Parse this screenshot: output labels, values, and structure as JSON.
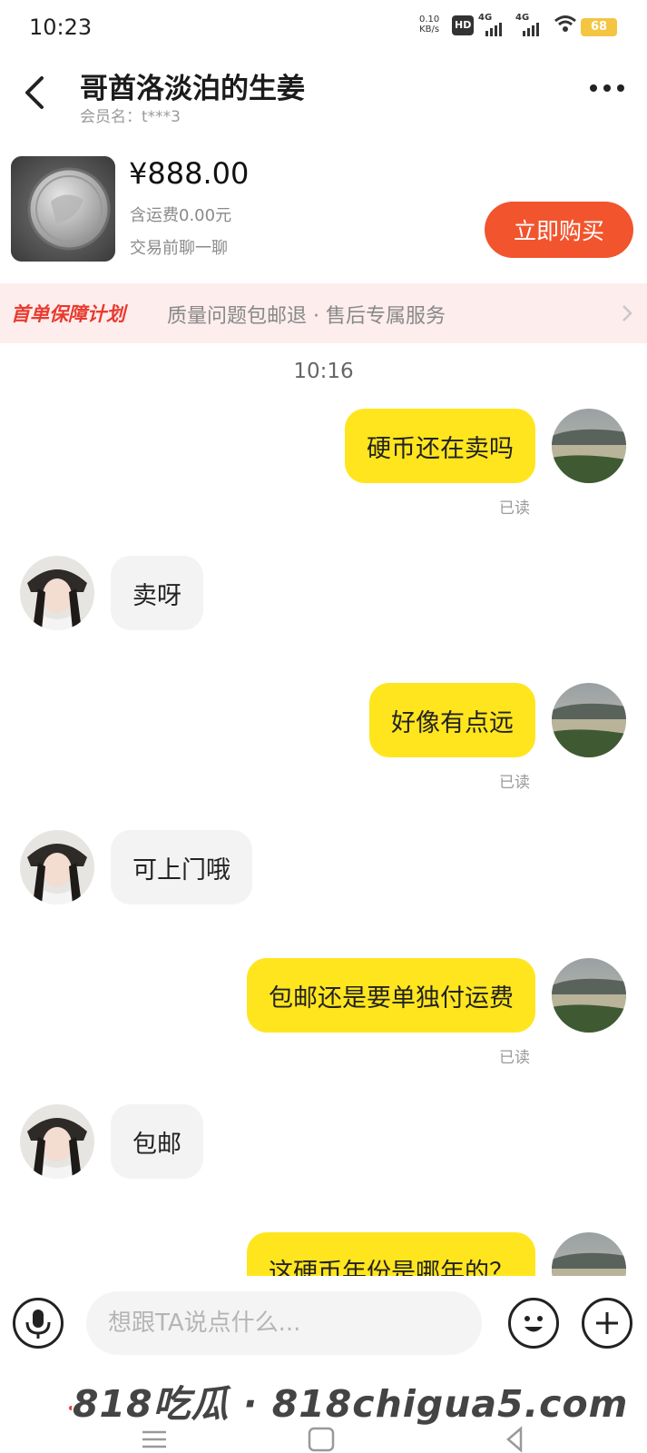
{
  "status_bar": {
    "time": "10:23",
    "net_speed_value": "0.10",
    "net_speed_unit": "KB/s",
    "hd_label": "HD",
    "signal_1_label": "4G",
    "signal_2_label": "4G",
    "battery": "68"
  },
  "header": {
    "title": "哥酋洛淡泊的生姜",
    "member_name": "会员名：t***3"
  },
  "product": {
    "price": "¥888.00",
    "shipping": "含运费0.00元",
    "chat_hint": "交易前聊一聊",
    "buy_label": "立即购买"
  },
  "protection": {
    "title": "首单保障计划",
    "text": "质量问题包邮退 · 售后专属服务"
  },
  "chat": {
    "time": "10:16",
    "messages": [
      {
        "text": "硬币还在卖吗",
        "status": "已读"
      },
      {
        "text": "卖呀"
      },
      {
        "text": "好像有点远",
        "status": "已读"
      },
      {
        "text": "可上门哦"
      },
      {
        "text": "包邮还是要单独付运费",
        "status": "已读"
      },
      {
        "text": "包邮"
      },
      {
        "text": "这硬币年份是哪年的？"
      }
    ]
  },
  "input": {
    "placeholder": "想跟TA说点什么..."
  },
  "watermark": "818吃瓜 · 818chigua5.com",
  "colors": {
    "accent_buy": "#f2542d",
    "my_bubble": "#ffe51e",
    "their_bubble": "#f3f3f3",
    "banner_bg": "#fdeded",
    "banner_title": "#e93b2f"
  }
}
